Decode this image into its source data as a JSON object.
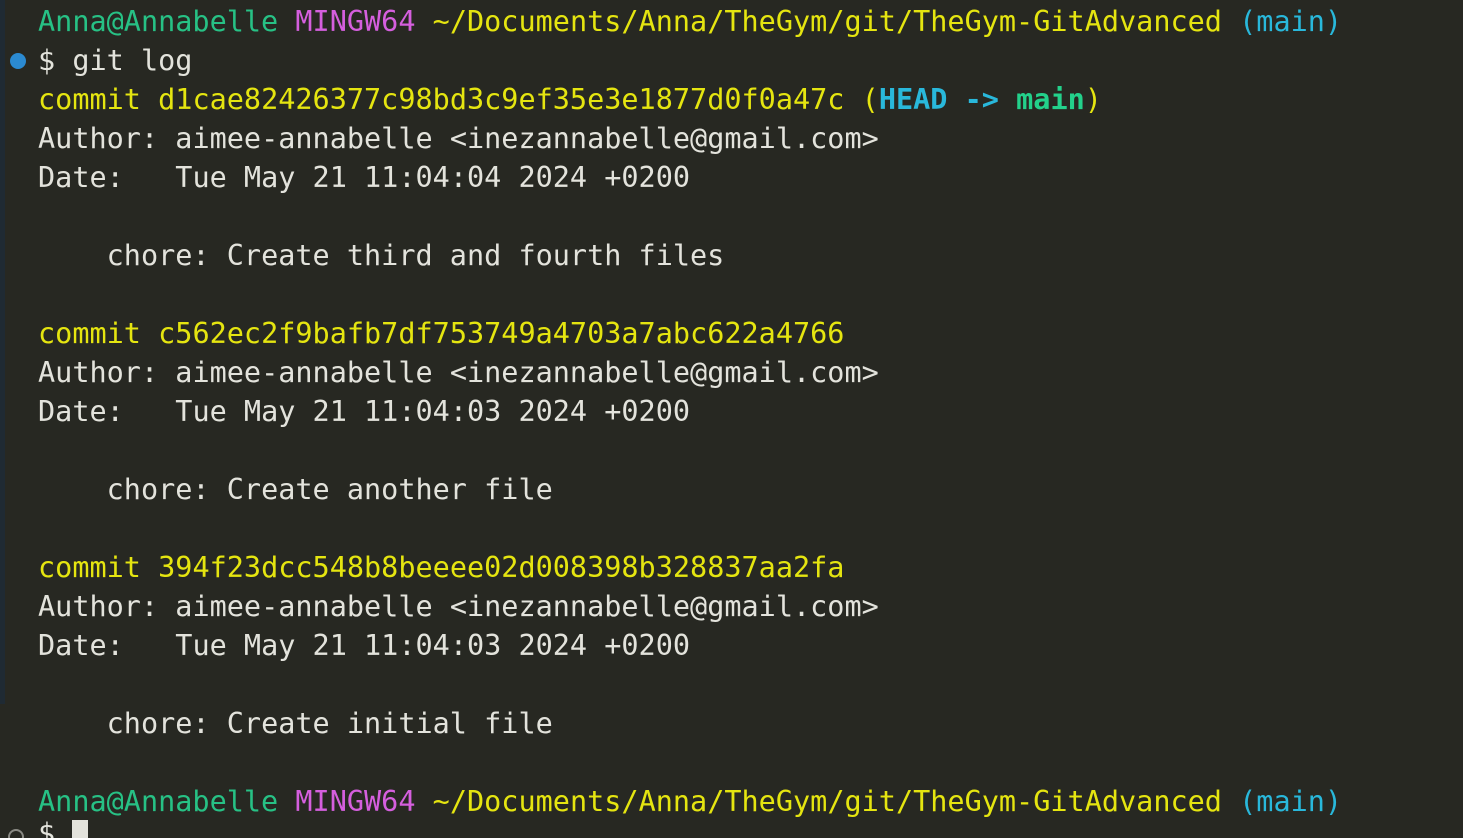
{
  "prompt": {
    "user_host": "Anna@Annabelle",
    "system": "MINGW64",
    "path": "~/Documents/Anna/TheGym/git/TheGym-GitAdvanced",
    "branch": "(main)",
    "symbol": "$"
  },
  "command": "git log",
  "head_ref": {
    "open": "(",
    "head": "HEAD",
    "arrow": "->",
    "branch": "main",
    "close": ")"
  },
  "commits": [
    {
      "label": "commit",
      "hash": "d1cae82426377c98bd3c9ef35e3e1877d0f0a47c",
      "author_label": "Author:",
      "author": "aimee-annabelle <inezannabelle@gmail.com>",
      "date_label": "Date:",
      "date": "Tue May 21 11:04:04 2024 +0200",
      "message": "chore: Create third and fourth files"
    },
    {
      "label": "commit",
      "hash": "c562ec2f9bafb7df753749a4703a7abc622a4766",
      "author_label": "Author:",
      "author": "aimee-annabelle <inezannabelle@gmail.com>",
      "date_label": "Date:",
      "date": "Tue May 21 11:04:03 2024 +0200",
      "message": "chore: Create another file"
    },
    {
      "label": "commit",
      "hash": "394f23dcc548b8beeee02d008398b328837aa2fa",
      "author_label": "Author:",
      "author": "aimee-annabelle <inezannabelle@gmail.com>",
      "date_label": "Date:",
      "date": "Tue May 21 11:04:03 2024 +0200",
      "message": "chore: Create initial file"
    }
  ],
  "colors": {
    "background": "#272822",
    "text": "#e3e3dc",
    "user_host": "#27c185",
    "system": "#d55fde",
    "path": "#e5e510",
    "branch": "#29b8db",
    "head": "#29b8db",
    "head_branch": "#23d18b",
    "command_marker": "#2b8ad1"
  }
}
